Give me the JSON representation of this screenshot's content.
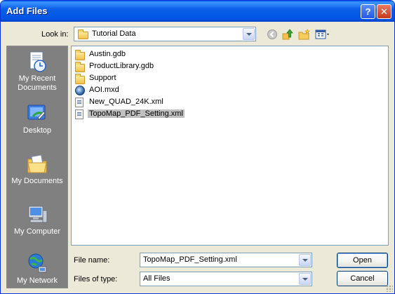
{
  "window": {
    "title": "Add Files",
    "help_label": "?",
    "close_label": "✕"
  },
  "toolbar": {
    "look_in_label": "Look in:",
    "look_in_value": "Tutorial Data",
    "icons": [
      "back-icon",
      "up-folder-icon",
      "new-folder-icon",
      "view-menu-icon"
    ]
  },
  "places": [
    {
      "label": "My Recent Documents",
      "icon": "recent-documents-icon"
    },
    {
      "label": "Desktop",
      "icon": "desktop-icon"
    },
    {
      "label": "My Documents",
      "icon": "my-documents-icon"
    },
    {
      "label": "My Computer",
      "icon": "my-computer-icon"
    },
    {
      "label": "My Network",
      "icon": "network-icon"
    }
  ],
  "files": [
    {
      "name": "Austin.gdb",
      "type": "folder"
    },
    {
      "name": "ProductLibrary.gdb",
      "type": "folder"
    },
    {
      "name": "Support",
      "type": "folder"
    },
    {
      "name": "AOI.mxd",
      "type": "mxd"
    },
    {
      "name": "New_QUAD_24K.xml",
      "type": "xml"
    },
    {
      "name": "TopoMap_PDF_Setting.xml",
      "type": "xml",
      "selected": true
    }
  ],
  "form": {
    "file_name_label": "File name:",
    "file_name_value": "TopoMap_PDF_Setting.xml",
    "file_type_label": "Files of type:",
    "file_type_value": "All Files"
  },
  "buttons": {
    "open_label": "Open",
    "cancel_label": "Cancel"
  },
  "colors": {
    "titlebar": "#0054e3",
    "dialog_bg": "#ece9d8",
    "places_bg": "#808080",
    "selection": "#c0c0c0"
  }
}
